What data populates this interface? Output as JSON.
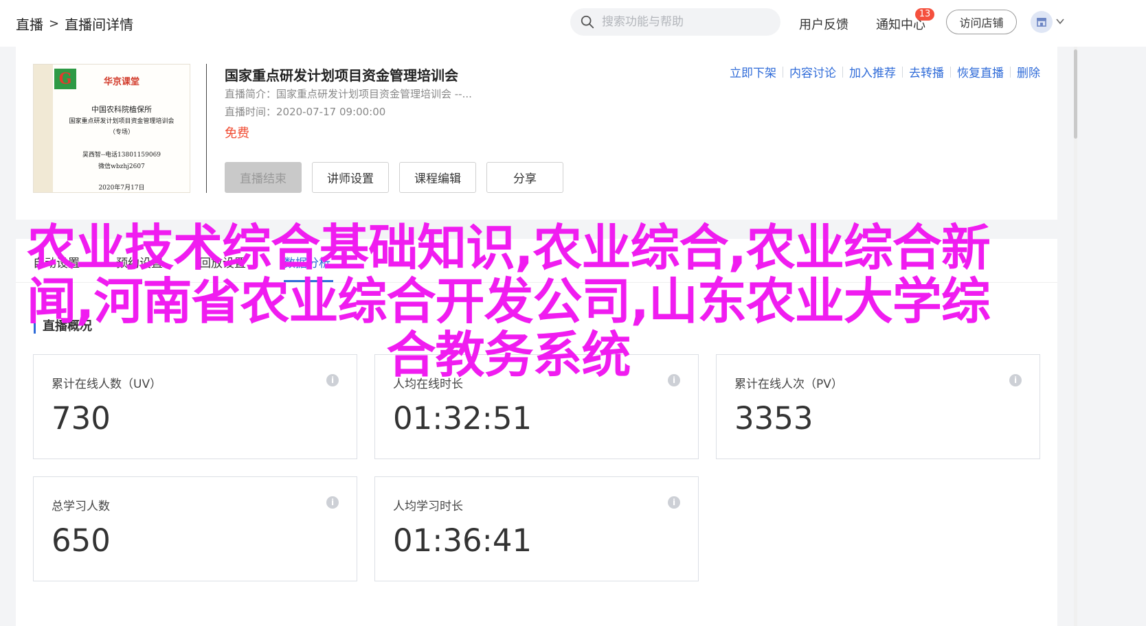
{
  "header": {
    "breadcrumb": [
      "直播",
      "直播间详情"
    ],
    "breadcrumb_separator": ">",
    "search_placeholder": "搜索功能与帮助",
    "feedback_label": "用户反馈",
    "notifications_label": "通知中心",
    "notifications_count": "13",
    "visit_store_label": "访问店铺"
  },
  "course": {
    "cover": {
      "brand": "华京课堂",
      "institute": "中国农科院植保所",
      "program": "国家重点研发计划项目资金管理培训会",
      "type": "（专场）",
      "contact": "吴西智--电话13801159069",
      "wechat": "微信wbzhj2607",
      "date": "2020年7月17日"
    },
    "title": "国家重点研发计划项目资金管理培训会",
    "intro": "直播简介：国家重点研发计划项目资金管理培训会 --...",
    "time": "直播时间：2020-07-17 09:00:00",
    "price": "免费",
    "buttons": [
      "直播结束",
      "讲师设置",
      "课程编辑",
      "分享"
    ],
    "actions": [
      "立即下架",
      "内容讨论",
      "加入推荐",
      "去转播",
      "恢复直播",
      "删除"
    ]
  },
  "tabs": [
    "自动设置",
    "预约设置",
    "回放设置",
    "数据分析"
  ],
  "active_tab": "数据分析",
  "overview": {
    "title": "直播概况",
    "stats": [
      {
        "label": "累计在线人数（UV）",
        "value": "730"
      },
      {
        "label": "人均在线时长",
        "value": "01:32:51"
      },
      {
        "label": "累计在线人次（PV）",
        "value": "3353"
      },
      {
        "label": "总学习人数",
        "value": "650"
      },
      {
        "label": "人均学习时长",
        "value": "01:36:41"
      }
    ]
  },
  "overlay_headline": "农业技术综合基础知识,农业综合,农业综合新闻,河南省农业综合开发公司,山东农业大学综合教务系统",
  "colors": {
    "accent": "#2f6bd8",
    "price": "#f04a30",
    "badge": "#f5503d",
    "overlay": "#f01cf0"
  }
}
